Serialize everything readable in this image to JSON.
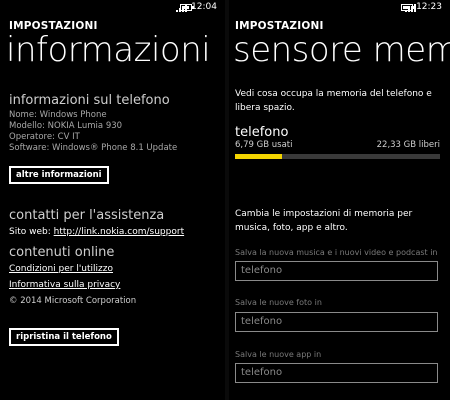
{
  "left": {
    "status": {
      "time": "12:04",
      "battery_level": 0.7
    },
    "app_title": "IMPOSTAZIONI",
    "page_title": "informazioni",
    "phone_section": {
      "heading": "informazioni sul telefono",
      "lines": [
        "Nome: Windows Phone",
        "Modello: NOKIA Lumia 930",
        "Operatore: CV IT",
        "Software: Windows® Phone 8.1 Update"
      ]
    },
    "more_info_button": "altre informazioni",
    "support": {
      "heading": "contatti per l'assistenza",
      "site_prefix": "Sito web:",
      "site_link": "http://link.nokia.com/support"
    },
    "online": {
      "heading": "contenuti online",
      "terms_link": "Condizioni per l'utilizzo",
      "privacy_link": "Informativa sulla privacy",
      "copyright": "© 2014 Microsoft Corporation"
    },
    "reset_button": "ripristina il telefono"
  },
  "right": {
    "status": {
      "time": "12:23",
      "battery_level": 0.7
    },
    "app_title": "IMPOSTAZIONI",
    "page_title": "sensore memori",
    "description": "Vedi cosa occupa la memoria del telefono e libera spazio.",
    "storage": {
      "label": "telefono",
      "used": "6,79 GB usati",
      "free": "22,33 GB liberi",
      "used_fraction": 0.23,
      "bar_color": "#f4d500"
    },
    "change_text": "Cambia le impostazioni di memoria per musica, foto, app e altro.",
    "settings": [
      {
        "label": "Salva la nuova musica e i nuovi video e podcast in",
        "value": "telefono"
      },
      {
        "label": "Salva le nuove foto in",
        "value": "telefono"
      },
      {
        "label": "Salva le nuove app in",
        "value": "telefono"
      }
    ]
  }
}
